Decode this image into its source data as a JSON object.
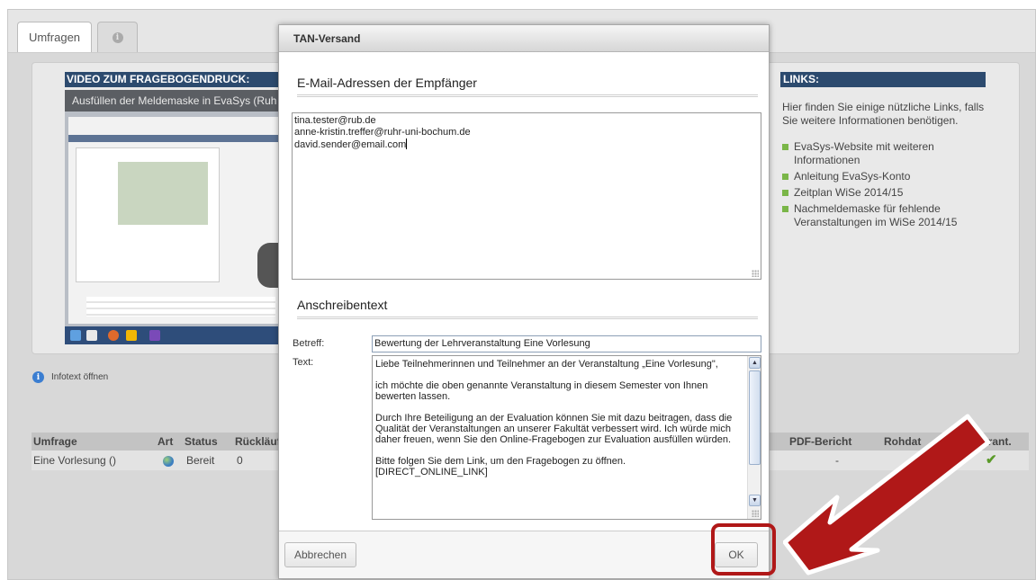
{
  "tabs": [
    {
      "label": "Umfragen",
      "icon": "info-icon"
    },
    {
      "label": "",
      "icon": "info-icon"
    }
  ],
  "video": {
    "heading": "VIDEO ZUM FRAGEBOGENDRUCK:",
    "title": "Ausfüllen der Meldemaske in EvaSys (Ruh"
  },
  "links": {
    "heading": "LINKS:",
    "intro": "Hier finden Sie einige nützliche Links, falls Sie weitere Informationen benötigen.",
    "items": [
      "EvaSys-Website mit weiteren Informationen",
      "Anleitung EvaSys-Konto",
      "Zeitplan WiSe 2014/15",
      "Nachmeldemaske für fehlende Veranstaltungen im WiSe 2014/15"
    ]
  },
  "infotext": "Infotext öffnen",
  "table": {
    "headers": {
      "umfrage": "Umfrage",
      "art": "Art",
      "status": "Status",
      "ruecklauf": "Rückläuf",
      "pdf": "PDF-Bericht",
      "rohdaten": "Rohdat",
      "verant": "erant."
    },
    "row": {
      "umfrage": "Eine Vorlesung ()",
      "status": "Bereit",
      "ruecklauf": "0",
      "pdf": "-"
    }
  },
  "dialog": {
    "title": "TAN-Versand",
    "emails_section": "E-Mail-Adressen der Empfänger",
    "emails": [
      "tina.tester@rub.de",
      "anne-kristin.treffer@ruhr-uni-bochum.de",
      "david.sender@email.com"
    ],
    "letter_section": "Anschreibentext",
    "subject_label": "Betreff:",
    "subject": "Bewertung der Lehrveranstaltung Eine Vorlesung",
    "text_label": "Text:",
    "text_paragraphs": [
      "Liebe Teilnehmerinnen und Teilnehmer an der Veranstaltung „Eine Vorlesung\",",
      "ich möchte die oben genannte Veranstaltung in diesem Semester von Ihnen bewerten lassen.",
      "Durch Ihre Beteiligung an der Evaluation können Sie mit dazu beitragen, dass die Qualität der Veranstaltungen an unserer Fakultät verbessert wird. Ich würde mich daher freuen, wenn Sie den Online-Fragebogen zur Evaluation ausfüllen würden.",
      "Bitte folgen Sie dem Link, um den Fragebogen zu öffnen.",
      "[DIRECT_ONLINE_LINK]"
    ],
    "cancel_label": "Abbrechen",
    "ok_label": "OK"
  },
  "colors": {
    "heading_bar": "#2c4a6e",
    "highlight": "#b01818",
    "bullet": "#7ab648"
  }
}
